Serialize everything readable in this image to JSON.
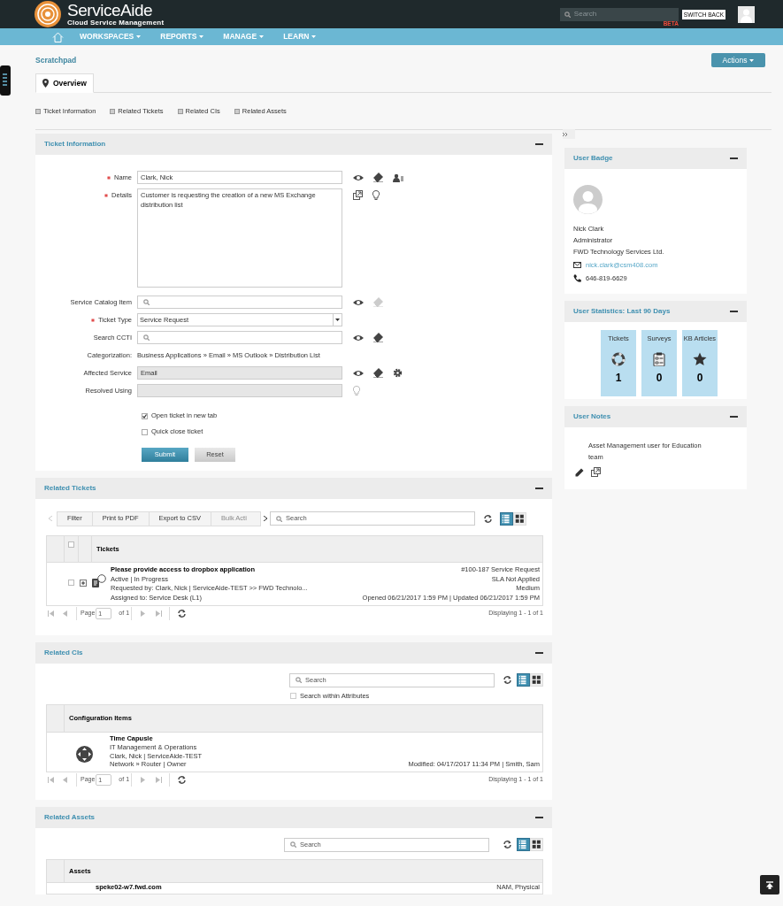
{
  "header": {
    "logo_title": "**Service**Aide",
    "logo_subtitle": "Cloud Service Management",
    "search": {
      "placeholder": "Search"
    },
    "beta": "BETA",
    "switch_back": "SWITCH BACK"
  },
  "nav": [
    {
      "label": "WORKSPACES"
    },
    {
      "label": "REPORTS"
    },
    {
      "label": "MANAGE"
    },
    {
      "label": "LEARN"
    }
  ],
  "page": {
    "title": "Scratchpad",
    "actions_button": "Actions"
  },
  "tabs": [
    {
      "label": "Overview",
      "selected": true
    }
  ],
  "anchors": [
    "Ticket Information",
    "Related Tickets",
    "Related CIs",
    "Related Assets"
  ],
  "ticket_information": {
    "title": "Ticket Information",
    "fields": [
      {
        "kind": "text",
        "label": "Name",
        "required": true,
        "value": "Clark, Nick",
        "actions": [
          {
            "kind": "view",
            "disabled": false
          },
          {
            "kind": "clear",
            "disabled": false
          },
          {
            "kind": "contact",
            "disabled": false
          }
        ]
      },
      {
        "kind": "textarea",
        "label": "Details",
        "required": true,
        "value": "Customer is requesting the creation of a new MS Exchange distribution list",
        "actions": [
          {
            "kind": "popout",
            "disabled": false
          },
          {
            "kind": "suggest",
            "disabled": false
          }
        ]
      },
      {
        "kind": "search",
        "label": "Service Catalog Item",
        "required": false,
        "actions": [
          {
            "kind": "view",
            "disabled": false
          },
          {
            "kind": "clear",
            "disabled": true
          }
        ]
      },
      {
        "kind": "select",
        "label": "Ticket Type",
        "required": true,
        "value": "Service Request"
      },
      {
        "kind": "search",
        "label": "Search CCTI",
        "required": false,
        "actions": [
          {
            "kind": "view",
            "disabled": false
          },
          {
            "kind": "clear",
            "disabled": false
          }
        ]
      },
      {
        "kind": "static",
        "label": "Categorization:",
        "required": false,
        "value": "Business Applications » Email » MS Outlook » Distribution List"
      },
      {
        "kind": "readonly",
        "label": "Affected Service",
        "required": false,
        "value": "Email",
        "actions": [
          {
            "kind": "view",
            "disabled": false
          },
          {
            "kind": "clear",
            "disabled": false
          },
          {
            "kind": "settings",
            "disabled": false
          }
        ]
      },
      {
        "kind": "readonly",
        "label": "Resolved Using",
        "required": false,
        "actions": [
          {
            "kind": "suggest",
            "disabled": true
          }
        ]
      }
    ],
    "checkboxes": [
      {
        "label": "Open ticket in new tab",
        "checked": true
      },
      {
        "label": "Quick close ticket",
        "checked": false
      }
    ],
    "buttons": [
      {
        "kind": "primary",
        "label": "Submit"
      },
      {
        "kind": "secondary",
        "label": "Reset"
      }
    ]
  },
  "related_tickets": {
    "title": "Related Tickets",
    "toolbar": [
      {
        "label": "Filter",
        "disabled": false
      },
      {
        "label": "Print to PDF",
        "disabled": false
      },
      {
        "label": "Export to CSV",
        "disabled": false
      },
      {
        "label": "Bulk Acti",
        "disabled": true
      }
    ],
    "search": {
      "placeholder": "Search"
    },
    "view_toggle": [
      {
        "kind": "list",
        "selected": true
      },
      {
        "kind": "grid",
        "selected": false
      }
    ],
    "column": "Tickets",
    "select_all_checked": false,
    "rows": [
      {
        "checked": false,
        "title": "Please provide access to dropbox application",
        "status": "Active | In Progress",
        "requested": "Requested by: Clark, Nick | ServiceAide-TEST >> FWD Technolo...",
        "assigned": "Assigned to: Service Desk (L1)",
        "right": [
          "#100-187 Service Request",
          "SLA Not Applied",
          "Medium",
          "Opened 06/21/2017 1:59 PM | Updated 06/21/2017 1:59 PM"
        ]
      }
    ],
    "pager": {
      "page_label": "Page",
      "page": "1",
      "of": "of 1",
      "displaying": "Displaying 1 - 1 of 1"
    }
  },
  "related_cis": {
    "title": "Related CIs",
    "search": {
      "placeholder": "Search"
    },
    "view_toggle": [
      {
        "kind": "list",
        "selected": true
      },
      {
        "kind": "grid",
        "selected": false
      }
    ],
    "search_within": {
      "label": "Search within Attributes",
      "checked": false
    },
    "column": "Configuration Items",
    "rows": [
      {
        "title": "Time Capusle",
        "lines": [
          "IT Management & Operations",
          "Clark, Nick | ServiceAide-TEST",
          "Network » Router | Owner"
        ],
        "modified": "Modified: 04/17/2017 11:34 PM | Smith, Sam"
      }
    ],
    "pager": {
      "page_label": "Page",
      "page": "1",
      "of": "of 1",
      "displaying": "Displaying 1 - 1 of 1"
    }
  },
  "related_assets": {
    "title": "Related Assets",
    "search": {
      "placeholder": "Search"
    },
    "view_toggle": [
      {
        "kind": "list",
        "selected": true
      },
      {
        "kind": "grid",
        "selected": false
      }
    ],
    "column": "Assets",
    "rows": [
      {
        "title": "speke02-w7.fwd.com",
        "right": "NAM, Physical"
      }
    ]
  },
  "user_badge": {
    "title": "User Badge",
    "name": "Nick Clark",
    "role": "Administrator",
    "company": "FWD Technology Services Ltd.",
    "email": "nick.clark@csm408.com",
    "phone": "646-819-6629"
  },
  "user_statistics": {
    "title": "User Statistics: Last 90 Days",
    "tiles": [
      {
        "kind": "tickets",
        "label": "Tickets",
        "value": "1"
      },
      {
        "kind": "surveys",
        "label": "Surveys",
        "value": "0"
      },
      {
        "kind": "articles",
        "label": "KB Articles",
        "value": "0"
      }
    ]
  },
  "user_notes": {
    "title": "User Notes",
    "text": "Asset Management user for Education team"
  }
}
